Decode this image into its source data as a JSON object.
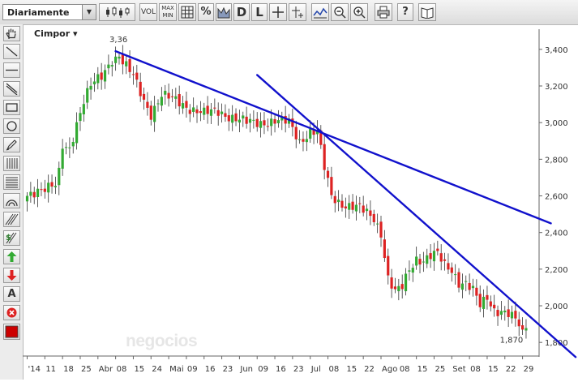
{
  "toolbar": {
    "period_select": "Diariamente",
    "buttons": [
      {
        "name": "candlestick-chart-button",
        "icon": "candlestick-icon"
      },
      {
        "name": "volume-button",
        "label": "VOL"
      },
      {
        "name": "maxmin-button",
        "label": "MAX MIN"
      },
      {
        "name": "grid-button",
        "icon": "grid-icon"
      },
      {
        "name": "percent-button",
        "label": "%"
      },
      {
        "name": "area-chart-button",
        "icon": "area-icon"
      },
      {
        "name": "daily-button",
        "label": "D"
      },
      {
        "name": "log-button",
        "label": "L"
      },
      {
        "name": "crosshair-button",
        "icon": "crosshair-icon"
      },
      {
        "name": "cursor-button",
        "icon": "cursor-icon"
      },
      {
        "name": "indicator-button",
        "icon": "wave-icon"
      },
      {
        "name": "zoom-out-button",
        "icon": "zoom-out-icon"
      },
      {
        "name": "zoom-in-button",
        "icon": "zoom-in-icon"
      },
      {
        "name": "print-button",
        "icon": "printer-icon"
      },
      {
        "name": "help-button",
        "label": "?"
      },
      {
        "name": "book-button",
        "icon": "book-icon"
      }
    ]
  },
  "sidebar": {
    "tools": [
      "hand-icon",
      "line-icon",
      "horizontal-line-icon",
      "channel-icon",
      "rectangle-icon",
      "circle-icon",
      "pencil-icon",
      "vertical-lines-icon",
      "fibonacci-icon",
      "arc-icon",
      "fan-icon",
      "dollar-icon",
      "arrow-up-icon",
      "arrow-down-icon",
      "text-icon",
      "delete-icon",
      "color-icon"
    ],
    "text_tool_label": "A"
  },
  "chart_data": {
    "type": "candlestick",
    "title": "Cimpor",
    "y_ticks": [
      "1,800",
      "2,000",
      "2,200",
      "2,400",
      "2,600",
      "2,800",
      "3,000",
      "3,200",
      "3,400"
    ],
    "ylim": [
      1.73,
      3.51
    ],
    "x_ticks": [
      "'14",
      "11",
      "18",
      "25",
      "Abr",
      "08",
      "15",
      "24",
      "Mai",
      "09",
      "16",
      "23",
      "Jun",
      "09",
      "16",
      "23",
      "Jul",
      "08",
      "15",
      "22",
      "Ago",
      "08",
      "15",
      "25",
      "Set",
      "08",
      "15",
      "22",
      "29"
    ],
    "x_tick_index": [
      0,
      5,
      10,
      15,
      20,
      25,
      30,
      35,
      40,
      45,
      50,
      55,
      60,
      65,
      70,
      75,
      80,
      85,
      90,
      95,
      100,
      105,
      110,
      115,
      120,
      125,
      130,
      135,
      140
    ],
    "high_label": "3,36",
    "low_label": "1,870",
    "watermark": "negocios",
    "up_color": "#33aa33",
    "down_color": "#dd2222",
    "trendline_color": "#1111cc",
    "trendlines": [
      {
        "from": [
          25,
          3.39
        ],
        "to": [
          148,
          2.45
        ]
      },
      {
        "from": [
          65,
          3.26
        ],
        "to": [
          155,
          1.72
        ]
      }
    ],
    "anchors": [
      [
        0,
        2.6
      ],
      [
        3,
        2.64
      ],
      [
        8,
        2.65
      ],
      [
        9,
        2.72
      ],
      [
        10,
        2.87
      ],
      [
        12,
        2.86
      ],
      [
        14,
        3.0
      ],
      [
        16,
        3.12
      ],
      [
        18,
        3.2
      ],
      [
        21,
        3.25
      ],
      [
        24,
        3.35
      ],
      [
        26,
        3.36
      ],
      [
        30,
        3.25
      ],
      [
        33,
        3.12
      ],
      [
        35,
        3.05
      ],
      [
        38,
        3.15
      ],
      [
        42,
        3.12
      ],
      [
        46,
        3.08
      ],
      [
        50,
        3.05
      ],
      [
        54,
        3.06
      ],
      [
        58,
        3.03
      ],
      [
        62,
        3.0
      ],
      [
        66,
        3.0
      ],
      [
        70,
        3.01
      ],
      [
        74,
        3.0
      ],
      [
        77,
        2.9
      ],
      [
        80,
        2.95
      ],
      [
        82,
        2.95
      ],
      [
        84,
        2.75
      ],
      [
        86,
        2.6
      ],
      [
        88,
        2.57
      ],
      [
        90,
        2.55
      ],
      [
        94,
        2.53
      ],
      [
        98,
        2.48
      ],
      [
        100,
        2.4
      ],
      [
        102,
        2.15
      ],
      [
        104,
        2.07
      ],
      [
        106,
        2.1
      ],
      [
        108,
        2.2
      ],
      [
        110,
        2.26
      ],
      [
        112,
        2.25
      ],
      [
        114,
        2.27
      ],
      [
        116,
        2.28
      ],
      [
        118,
        2.22
      ],
      [
        120,
        2.2
      ],
      [
        122,
        2.13
      ],
      [
        124,
        2.12
      ],
      [
        126,
        2.08
      ],
      [
        128,
        2.0
      ],
      [
        130,
        2.05
      ],
      [
        132,
        1.98
      ],
      [
        134,
        1.97
      ],
      [
        136,
        1.95
      ],
      [
        138,
        1.92
      ],
      [
        140,
        1.87
      ],
      [
        141,
        1.9
      ]
    ]
  }
}
